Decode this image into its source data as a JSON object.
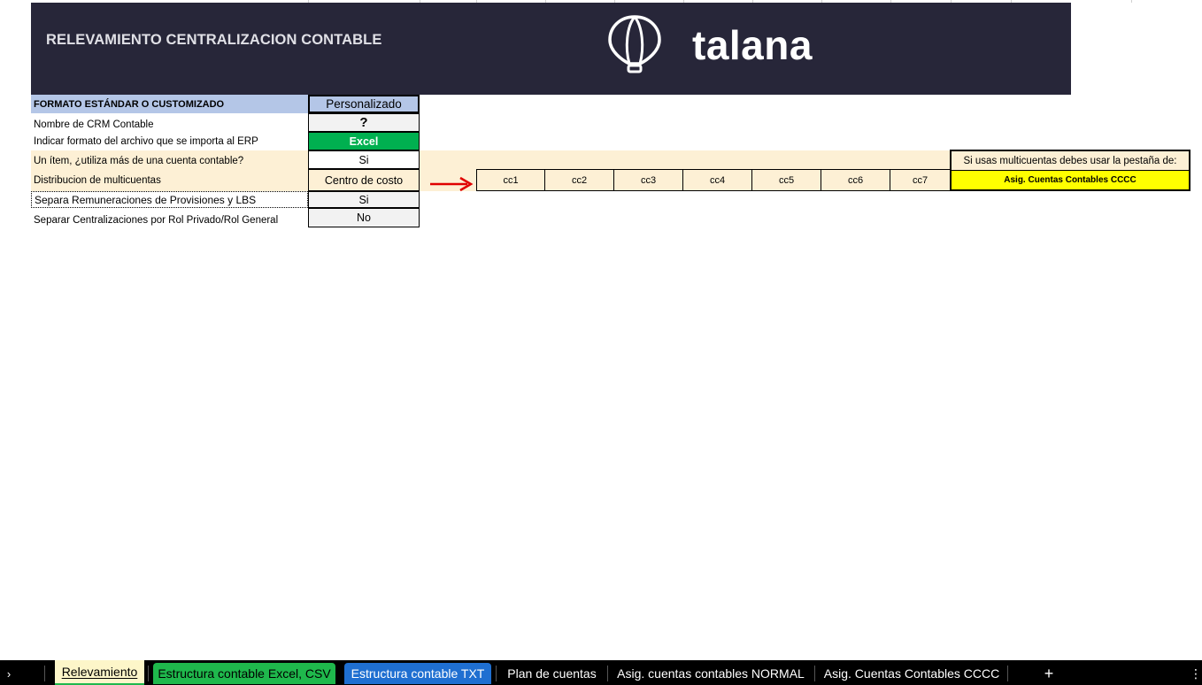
{
  "banner": {
    "title": "RELEVAMIENTO CENTRALIZACION CONTABLE",
    "logo_text": "talana"
  },
  "form": {
    "header_label": "FORMATO ESTÁNDAR O CUSTOMIZADO",
    "header_value": "Personalizado",
    "rows": [
      {
        "label": "Nombre de CRM Contable",
        "value": "?"
      },
      {
        "label": "Indicar formato del archivo que se importa al ERP",
        "value": "Excel"
      },
      {
        "label": "Un ítem, ¿utiliza más de una cuenta contable?",
        "value": "Si"
      },
      {
        "label": "Distribucion de multicuentas",
        "value": "Centro de costo"
      },
      {
        "label": "Separa Remuneraciones de Provisiones y LBS",
        "value": "Si"
      },
      {
        "label": "Separar Centralizaciones por Rol Privado/Rol General",
        "value": "No"
      }
    ]
  },
  "cost_centers": [
    "cc1",
    "cc2",
    "cc3",
    "cc4",
    "cc5",
    "cc6",
    "cc7"
  ],
  "note": {
    "text": "Si usas multicuentas debes usar la pestaña de:",
    "link": "Asig. Cuentas Contables CCCC"
  },
  "sheet_tabs": [
    {
      "label": "Relevamiento"
    },
    {
      "label": "Estructura contable Excel, CSV"
    },
    {
      "label": "Estructura contable TXT"
    },
    {
      "label": "Plan de cuentas"
    },
    {
      "label": "Asig. cuentas contables NORMAL"
    },
    {
      "label": "Asig. Cuentas Contables CCCC"
    }
  ],
  "colors": {
    "banner_bg": "#272639",
    "header_blue": "#b4c6e7",
    "highlight_peach": "#fdf0d5",
    "excel_green": "#00b050",
    "note_yellow": "#ffff00",
    "arrow_red": "#e00000",
    "tab_green": "#1fb84c",
    "tab_blue": "#1f6fd1"
  },
  "icons": {
    "balloon": "balloon-logo-icon",
    "add_sheet": "plus-icon",
    "nav": "chevron-right-icon",
    "more": "vertical-dots-icon"
  }
}
